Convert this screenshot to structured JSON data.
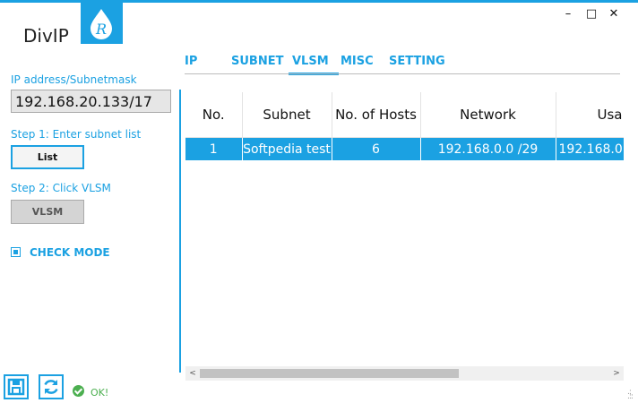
{
  "app": {
    "title": "DivIP",
    "logo_letter": "R"
  },
  "window": {
    "minimize": "–",
    "maximize": "□",
    "close": "✕"
  },
  "sidebar": {
    "ip_label": "IP address/Subnetmask",
    "ip_value": "192.168.20.133/17",
    "step1_label": "Step 1: Enter subnet list",
    "list_button": "List",
    "step2_label": "Step 2: Click VLSM",
    "vlsm_button": "VLSM",
    "check_mode_label": "CHECK MODE",
    "check_mode_checked": true
  },
  "tabs": [
    {
      "label": "IP"
    },
    {
      "label": "SUBNET"
    },
    {
      "label": "VLSM",
      "active": true
    },
    {
      "label": "MISC"
    },
    {
      "label": "SETTING"
    }
  ],
  "table": {
    "columns": [
      "No.",
      "Subnet",
      "No. of Hosts",
      "Network",
      "Usa"
    ],
    "rows": [
      [
        "1",
        "Softpedia test",
        "6",
        "192.168.0.0 /29",
        "192.168.0"
      ]
    ]
  },
  "scrollbar": {
    "left_arrow": "<",
    "right_arrow": ">"
  },
  "status": {
    "text": "OK!"
  },
  "colors": {
    "accent": "#1ba1e2",
    "ok": "#4caf50",
    "input_bg": "#e6e6e6"
  }
}
